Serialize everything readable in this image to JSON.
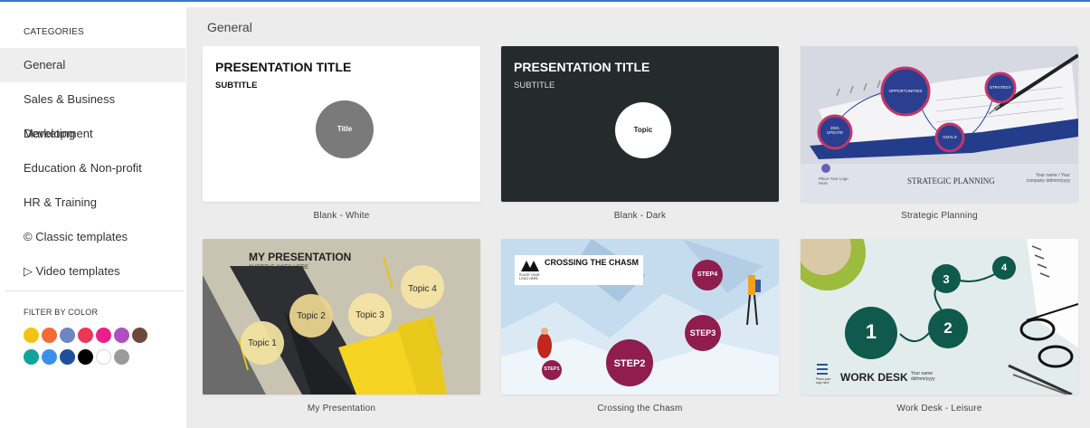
{
  "sidebar": {
    "categories_heading": "CATEGORIES",
    "categories": [
      {
        "label": "General",
        "active": true
      },
      {
        "label": "Sales & Business Development",
        "active": false
      },
      {
        "label": "Marketing",
        "active": false
      },
      {
        "label": "Education & Non-profit",
        "active": false
      },
      {
        "label": "HR & Training",
        "active": false
      },
      {
        "label": "© Classic templates",
        "active": false
      },
      {
        "label": "▷ Video templates",
        "active": false
      }
    ],
    "filter_heading": "FILTER BY COLOR",
    "colors": [
      "#f2c40f",
      "#f26b35",
      "#6f85c2",
      "#ea3757",
      "#ec1e8b",
      "#b14fbf",
      "#6b4a3d",
      "#11a39c",
      "#3b8fe8",
      "#1d4f9b",
      "#000000",
      "#ffffff",
      "#9a9a9a"
    ]
  },
  "main": {
    "section_title": "General",
    "templates": [
      {
        "name": "Blank - White",
        "title": "PRESENTATION TITLE",
        "subtitle": "SUBTITLE",
        "circle_text": "Title"
      },
      {
        "name": "Blank - Dark",
        "title": "PRESENTATION TITLE",
        "subtitle": "SUBTITLE",
        "circle_text": "Topic"
      },
      {
        "name": "Strategic Planning",
        "bubbles": [
          "OPPORTUNITIES",
          "STRATEGY",
          "2021 UPDATE",
          "GOALS"
        ],
        "logo_text": "Place Your Logo Here",
        "heading": "STRATEGIC PLANNING",
        "meta": "Your name / Your company dd/mm/yyyy"
      },
      {
        "name": "My Presentation",
        "title": "MY PRESENTATION",
        "subtitle": "SUBTITLE GOES HERE",
        "topics": [
          "Topic 1",
          "Topic 2",
          "Topic 3",
          "Topic 4"
        ]
      },
      {
        "name": "Crossing the Chasm",
        "title": "CROSSING THE CHASM",
        "logo_text": "PLACE YOUR LOGO HERE",
        "steps": [
          "STEP1",
          "STEP2",
          "STEP3",
          "STEP4"
        ]
      },
      {
        "name": "Work Desk - Leisure",
        "numbers": [
          "1",
          "2",
          "3",
          "4"
        ],
        "heading": "WORK DESK",
        "logo_text": "Place your logo here",
        "meta": "Your name dd/mm/yyyy"
      }
    ]
  }
}
